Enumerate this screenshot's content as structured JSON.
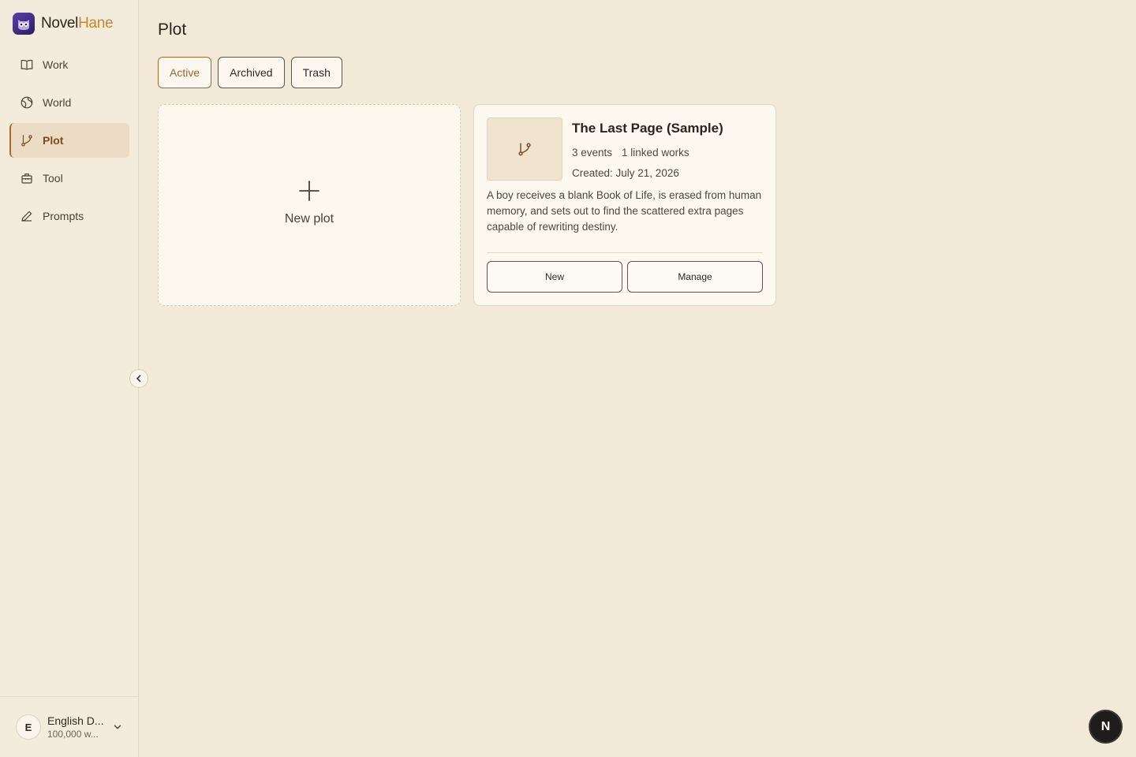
{
  "brand": {
    "name_part1": "Novel",
    "name_part2": "Hane"
  },
  "sidebar": {
    "items": [
      {
        "label": "Work",
        "icon": "book-open-icon"
      },
      {
        "label": "World",
        "icon": "globe-icon"
      },
      {
        "label": "Plot",
        "icon": "git-branch-icon",
        "active": true
      },
      {
        "label": "Tool",
        "icon": "toolbox-icon"
      },
      {
        "label": "Prompts",
        "icon": "pen-icon"
      }
    ]
  },
  "account": {
    "initial": "E",
    "name": "English D...",
    "subtitle": "100,000 w..."
  },
  "main": {
    "title": "Plot",
    "tabs": [
      {
        "label": "Active",
        "active": true
      },
      {
        "label": "Archived"
      },
      {
        "label": "Trash"
      }
    ],
    "new_card_label": "New plot",
    "plots": [
      {
        "title": "The Last Page (Sample)",
        "events": "3 events",
        "linked": "1 linked works",
        "created": "Created: July 21, 2026",
        "description": "A boy receives a blank Book of Life, is erased from human memory, and sets out to find the scattered extra pages capable of rewriting destiny.",
        "new_button": "New",
        "manage_button": "Manage"
      }
    ]
  },
  "fab_label": "N",
  "colors": {
    "background": "#f2e9d8",
    "accent": "#a0642b",
    "brand_accent": "#c8872e"
  }
}
